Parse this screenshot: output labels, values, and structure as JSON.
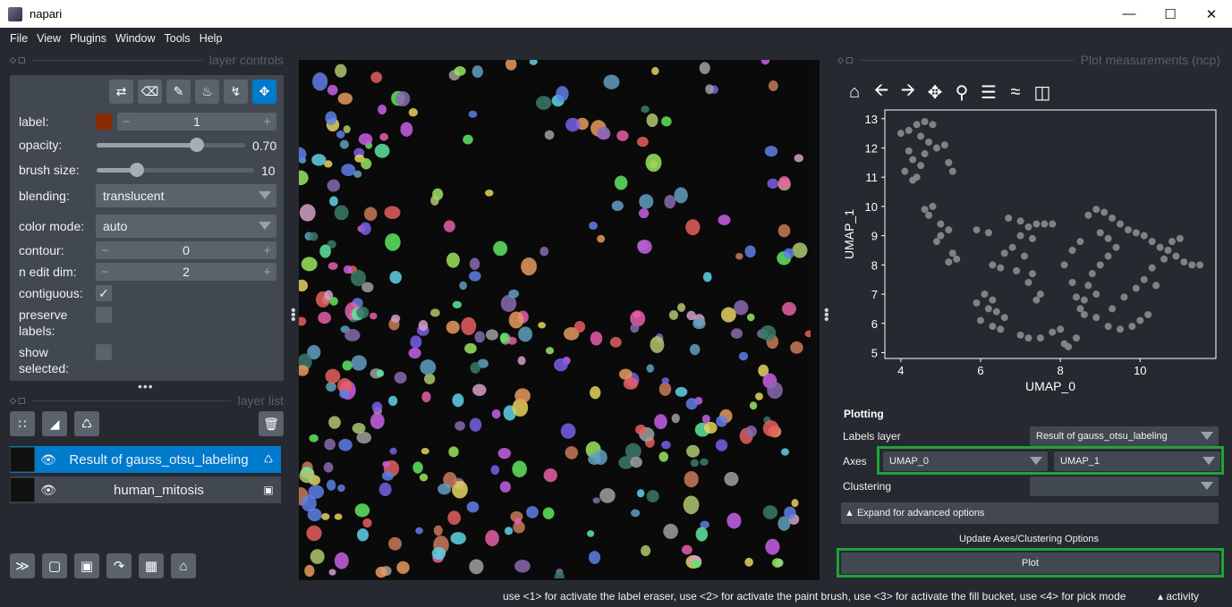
{
  "window": {
    "title": "napari"
  },
  "menu": [
    "File",
    "View",
    "Plugins",
    "Window",
    "Tools",
    "Help"
  ],
  "layer_controls": {
    "header": "layer controls",
    "label_label": "label:",
    "label_value": "1",
    "label_color": "#8a2a00",
    "opacity_label": "opacity:",
    "opacity_value": "0.70",
    "opacity_fraction": 0.7,
    "brush_label": "brush size:",
    "brush_value": "10",
    "blending_label": "blending:",
    "blending_value": "translucent",
    "color_mode_label": "color mode:",
    "color_mode_value": "auto",
    "contour_label": "contour:",
    "contour_value": "0",
    "n_edit_label": "n edit dim:",
    "n_edit_value": "2",
    "contiguous_label": "contiguous:",
    "contiguous_checked": true,
    "preserve_label_1": "preserve",
    "preserve_label_2": "labels:",
    "show_selected_1": "show",
    "show_selected_2": "selected:"
  },
  "layer_list": {
    "header": "layer list",
    "layers": [
      {
        "name": "Result of gauss_otsu_labeling",
        "selected": true
      },
      {
        "name": "human_mitosis",
        "selected": false
      }
    ]
  },
  "plot": {
    "header": "Plot measurements (ncp)",
    "plotting_title": "Plotting",
    "labels_layer_label": "Labels layer",
    "labels_layer_value": "Result of gauss_otsu_labeling",
    "axes_label": "Axes",
    "axis_x_value": "UMAP_0",
    "axis_y_value": "UMAP_1",
    "clustering_label": "Clustering",
    "clustering_value": "",
    "expand_label": "▲ Expand for advanced options",
    "update_button": "Update Axes/Clustering Options",
    "plot_button": "Plot"
  },
  "chart_data": {
    "type": "scatter",
    "xlabel": "UMAP_0",
    "ylabel": "UMAP_1",
    "xlim": [
      3.6,
      11.9
    ],
    "ylim": [
      4.8,
      13.3
    ],
    "xticks": [
      4,
      6,
      8,
      10
    ],
    "yticks": [
      5,
      6,
      7,
      8,
      9,
      10,
      11,
      12,
      13
    ],
    "point_color": "#8c8c8c",
    "points": [
      [
        4.0,
        12.5
      ],
      [
        4.2,
        12.6
      ],
      [
        4.4,
        12.8
      ],
      [
        4.6,
        12.9
      ],
      [
        4.8,
        12.8
      ],
      [
        4.5,
        12.4
      ],
      [
        4.7,
        12.2
      ],
      [
        4.9,
        12.0
      ],
      [
        5.1,
        12.1
      ],
      [
        4.3,
        11.6
      ],
      [
        4.5,
        11.4
      ],
      [
        4.1,
        11.2
      ],
      [
        4.3,
        10.9
      ],
      [
        4.2,
        11.9
      ],
      [
        4.6,
        11.8
      ],
      [
        5.2,
        11.5
      ],
      [
        5.3,
        11.2
      ],
      [
        4.4,
        11.0
      ],
      [
        4.6,
        9.9
      ],
      [
        4.8,
        10.0
      ],
      [
        4.7,
        9.7
      ],
      [
        5.0,
        9.4
      ],
      [
        5.2,
        9.2
      ],
      [
        5.0,
        9.0
      ],
      [
        4.9,
        8.8
      ],
      [
        5.3,
        8.4
      ],
      [
        5.2,
        8.1
      ],
      [
        5.4,
        8.2
      ],
      [
        5.9,
        9.2
      ],
      [
        6.2,
        9.1
      ],
      [
        6.7,
        9.6
      ],
      [
        7.0,
        9.5
      ],
      [
        7.2,
        9.3
      ],
      [
        7.4,
        9.4
      ],
      [
        7.6,
        9.4
      ],
      [
        7.8,
        9.4
      ],
      [
        7.0,
        9.0
      ],
      [
        7.3,
        8.9
      ],
      [
        6.8,
        8.6
      ],
      [
        6.6,
        8.4
      ],
      [
        7.1,
        8.3
      ],
      [
        6.3,
        8.0
      ],
      [
        6.5,
        7.9
      ],
      [
        6.9,
        7.8
      ],
      [
        7.3,
        7.7
      ],
      [
        7.2,
        7.4
      ],
      [
        7.5,
        7.0
      ],
      [
        7.4,
        6.8
      ],
      [
        6.1,
        7.0
      ],
      [
        6.3,
        6.8
      ],
      [
        5.9,
        6.7
      ],
      [
        6.2,
        6.5
      ],
      [
        6.4,
        6.4
      ],
      [
        6.6,
        6.2
      ],
      [
        6.0,
        6.1
      ],
      [
        6.3,
        5.9
      ],
      [
        6.5,
        5.8
      ],
      [
        7.0,
        5.6
      ],
      [
        7.2,
        5.5
      ],
      [
        7.5,
        5.5
      ],
      [
        7.8,
        5.7
      ],
      [
        8.0,
        5.8
      ],
      [
        8.1,
        5.3
      ],
      [
        8.2,
        5.2
      ],
      [
        8.4,
        5.5
      ],
      [
        8.7,
        9.7
      ],
      [
        8.9,
        9.9
      ],
      [
        9.1,
        9.8
      ],
      [
        9.3,
        9.6
      ],
      [
        9.5,
        9.4
      ],
      [
        9.7,
        9.2
      ],
      [
        9.9,
        9.1
      ],
      [
        10.1,
        9.0
      ],
      [
        10.3,
        8.8
      ],
      [
        10.5,
        8.6
      ],
      [
        10.7,
        8.5
      ],
      [
        10.9,
        8.3
      ],
      [
        11.1,
        8.1
      ],
      [
        11.3,
        8.0
      ],
      [
        11.5,
        8.0
      ],
      [
        9.0,
        9.1
      ],
      [
        9.2,
        8.9
      ],
      [
        9.4,
        8.6
      ],
      [
        9.2,
        8.3
      ],
      [
        9.0,
        8.0
      ],
      [
        8.8,
        7.7
      ],
      [
        8.7,
        7.3
      ],
      [
        8.9,
        7.0
      ],
      [
        8.6,
        6.8
      ],
      [
        8.5,
        6.5
      ],
      [
        8.9,
        6.2
      ],
      [
        9.2,
        5.9
      ],
      [
        9.5,
        5.8
      ],
      [
        9.8,
        5.9
      ],
      [
        10.0,
        6.1
      ],
      [
        10.2,
        6.3
      ],
      [
        9.9,
        7.2
      ],
      [
        10.1,
        7.5
      ],
      [
        10.3,
        7.9
      ],
      [
        10.6,
        8.2
      ],
      [
        10.4,
        7.3
      ],
      [
        8.3,
        8.5
      ],
      [
        8.5,
        8.8
      ],
      [
        8.1,
        8.0
      ],
      [
        8.3,
        7.4
      ],
      [
        8.4,
        6.9
      ],
      [
        8.6,
        6.3
      ],
      [
        9.6,
        6.9
      ],
      [
        9.3,
        6.5
      ],
      [
        10.8,
        8.8
      ],
      [
        11.0,
        8.9
      ]
    ]
  }
}
